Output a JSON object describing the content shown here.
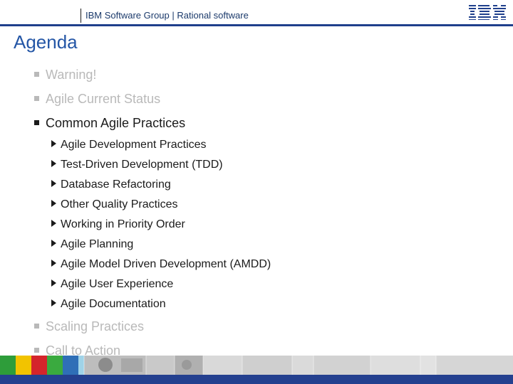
{
  "header": {
    "title": "IBM Software Group | Rational software",
    "logo_text": "IBM",
    "accent_color": "#1f3f8c"
  },
  "slide": {
    "title": "Agenda"
  },
  "agenda": {
    "items": [
      {
        "label": "Warning!",
        "state": "inactive"
      },
      {
        "label": "Agile Current Status",
        "state": "inactive"
      },
      {
        "label": "Common Agile Practices",
        "state": "active",
        "subitems": [
          "Agile Development Practices",
          "Test-Driven Development (TDD)",
          "Database Refactoring",
          "Other Quality Practices",
          "Working in Priority Order",
          "Agile Planning",
          "Agile Model Driven Development (AMDD)",
          "Agile User Experience",
          "Agile Documentation"
        ]
      },
      {
        "label": "Scaling Practices",
        "state": "inactive"
      },
      {
        "label": "Call to Action",
        "state": "inactive"
      }
    ]
  },
  "colors": {
    "active_text": "#1b1b1b",
    "inactive_text": "#b9b9b9",
    "title": "#2456a6",
    "footer_band": "#24408f"
  }
}
